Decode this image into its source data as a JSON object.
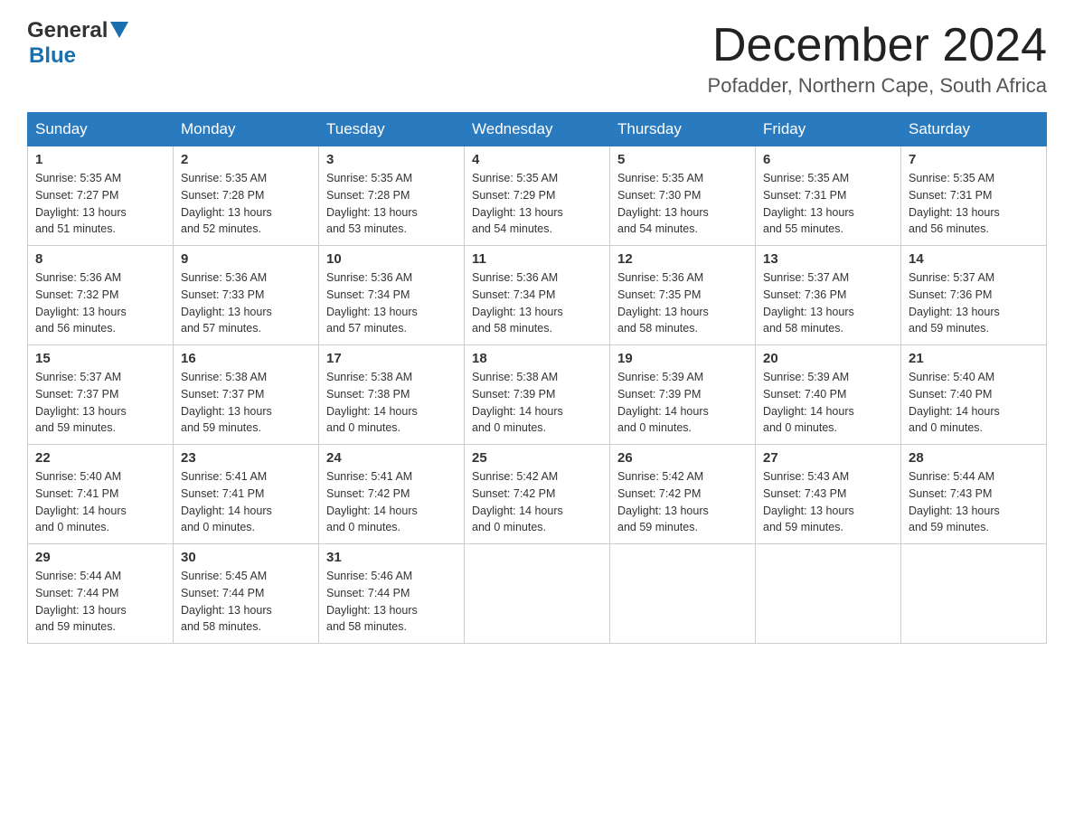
{
  "header": {
    "logo": {
      "text_general": "General",
      "text_blue": "Blue"
    },
    "month_title": "December 2024",
    "location": "Pofadder, Northern Cape, South Africa"
  },
  "days_of_week": [
    "Sunday",
    "Monday",
    "Tuesday",
    "Wednesday",
    "Thursday",
    "Friday",
    "Saturday"
  ],
  "weeks": [
    [
      {
        "day": "1",
        "sunrise": "5:35 AM",
        "sunset": "7:27 PM",
        "daylight": "13 hours and 51 minutes."
      },
      {
        "day": "2",
        "sunrise": "5:35 AM",
        "sunset": "7:28 PM",
        "daylight": "13 hours and 52 minutes."
      },
      {
        "day": "3",
        "sunrise": "5:35 AM",
        "sunset": "7:28 PM",
        "daylight": "13 hours and 53 minutes."
      },
      {
        "day": "4",
        "sunrise": "5:35 AM",
        "sunset": "7:29 PM",
        "daylight": "13 hours and 54 minutes."
      },
      {
        "day": "5",
        "sunrise": "5:35 AM",
        "sunset": "7:30 PM",
        "daylight": "13 hours and 54 minutes."
      },
      {
        "day": "6",
        "sunrise": "5:35 AM",
        "sunset": "7:31 PM",
        "daylight": "13 hours and 55 minutes."
      },
      {
        "day": "7",
        "sunrise": "5:35 AM",
        "sunset": "7:31 PM",
        "daylight": "13 hours and 56 minutes."
      }
    ],
    [
      {
        "day": "8",
        "sunrise": "5:36 AM",
        "sunset": "7:32 PM",
        "daylight": "13 hours and 56 minutes."
      },
      {
        "day": "9",
        "sunrise": "5:36 AM",
        "sunset": "7:33 PM",
        "daylight": "13 hours and 57 minutes."
      },
      {
        "day": "10",
        "sunrise": "5:36 AM",
        "sunset": "7:34 PM",
        "daylight": "13 hours and 57 minutes."
      },
      {
        "day": "11",
        "sunrise": "5:36 AM",
        "sunset": "7:34 PM",
        "daylight": "13 hours and 58 minutes."
      },
      {
        "day": "12",
        "sunrise": "5:36 AM",
        "sunset": "7:35 PM",
        "daylight": "13 hours and 58 minutes."
      },
      {
        "day": "13",
        "sunrise": "5:37 AM",
        "sunset": "7:36 PM",
        "daylight": "13 hours and 58 minutes."
      },
      {
        "day": "14",
        "sunrise": "5:37 AM",
        "sunset": "7:36 PM",
        "daylight": "13 hours and 59 minutes."
      }
    ],
    [
      {
        "day": "15",
        "sunrise": "5:37 AM",
        "sunset": "7:37 PM",
        "daylight": "13 hours and 59 minutes."
      },
      {
        "day": "16",
        "sunrise": "5:38 AM",
        "sunset": "7:37 PM",
        "daylight": "13 hours and 59 minutes."
      },
      {
        "day": "17",
        "sunrise": "5:38 AM",
        "sunset": "7:38 PM",
        "daylight": "14 hours and 0 minutes."
      },
      {
        "day": "18",
        "sunrise": "5:38 AM",
        "sunset": "7:39 PM",
        "daylight": "14 hours and 0 minutes."
      },
      {
        "day": "19",
        "sunrise": "5:39 AM",
        "sunset": "7:39 PM",
        "daylight": "14 hours and 0 minutes."
      },
      {
        "day": "20",
        "sunrise": "5:39 AM",
        "sunset": "7:40 PM",
        "daylight": "14 hours and 0 minutes."
      },
      {
        "day": "21",
        "sunrise": "5:40 AM",
        "sunset": "7:40 PM",
        "daylight": "14 hours and 0 minutes."
      }
    ],
    [
      {
        "day": "22",
        "sunrise": "5:40 AM",
        "sunset": "7:41 PM",
        "daylight": "14 hours and 0 minutes."
      },
      {
        "day": "23",
        "sunrise": "5:41 AM",
        "sunset": "7:41 PM",
        "daylight": "14 hours and 0 minutes."
      },
      {
        "day": "24",
        "sunrise": "5:41 AM",
        "sunset": "7:42 PM",
        "daylight": "14 hours and 0 minutes."
      },
      {
        "day": "25",
        "sunrise": "5:42 AM",
        "sunset": "7:42 PM",
        "daylight": "14 hours and 0 minutes."
      },
      {
        "day": "26",
        "sunrise": "5:42 AM",
        "sunset": "7:42 PM",
        "daylight": "13 hours and 59 minutes."
      },
      {
        "day": "27",
        "sunrise": "5:43 AM",
        "sunset": "7:43 PM",
        "daylight": "13 hours and 59 minutes."
      },
      {
        "day": "28",
        "sunrise": "5:44 AM",
        "sunset": "7:43 PM",
        "daylight": "13 hours and 59 minutes."
      }
    ],
    [
      {
        "day": "29",
        "sunrise": "5:44 AM",
        "sunset": "7:44 PM",
        "daylight": "13 hours and 59 minutes."
      },
      {
        "day": "30",
        "sunrise": "5:45 AM",
        "sunset": "7:44 PM",
        "daylight": "13 hours and 58 minutes."
      },
      {
        "day": "31",
        "sunrise": "5:46 AM",
        "sunset": "7:44 PM",
        "daylight": "13 hours and 58 minutes."
      },
      null,
      null,
      null,
      null
    ]
  ],
  "labels": {
    "sunrise": "Sunrise:",
    "sunset": "Sunset:",
    "daylight": "Daylight:"
  }
}
